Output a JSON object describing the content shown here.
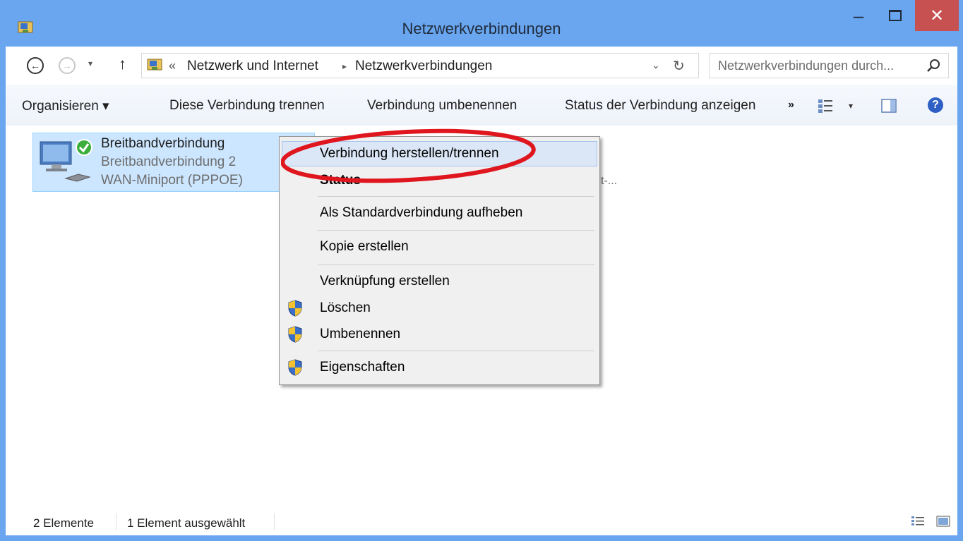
{
  "window": {
    "title": "Netzwerkverbindungen",
    "minimize_glyph": "‒",
    "close_glyph": "✕"
  },
  "address_bar": {
    "back_glyph": "←",
    "forward_glyph": "→",
    "history_glyph": "▾",
    "up_glyph": "↑",
    "overflow_glyph": "«",
    "breadcrumbs": [
      "Netzwerk und Internet",
      "Netzwerkverbindungen"
    ],
    "crumb_separator": "▸",
    "dropdown_glyph": "⌄",
    "refresh_glyph": "↻",
    "search_placeholder": "Netzwerkverbindungen durch..."
  },
  "toolbar": {
    "organize": "Organisieren ▾",
    "disconnect": "Diese Verbindung trennen",
    "rename": "Verbindung umbenennen",
    "status": "Status der Verbindung anzeigen",
    "more": "»",
    "view_drop": "▾",
    "help": "?"
  },
  "connection": {
    "name": "Breitbandverbindung",
    "subtitle": "Breitbandverbindung 2",
    "device": "WAN-Miniport (PPPOE)",
    "partial_text": "t-..."
  },
  "context_menu": {
    "items": [
      {
        "label": "Verbindung herstellen/trennen",
        "shield": false,
        "highlighted": true
      },
      {
        "label": "Status",
        "shield": false,
        "bold": true
      },
      {
        "label": "Als Standardverbindung aufheben",
        "shield": false
      },
      {
        "label": "Kopie erstellen",
        "shield": false
      },
      {
        "label": "Verknüpfung erstellen",
        "shield": false
      },
      {
        "label": "Löschen",
        "shield": true
      },
      {
        "label": "Umbenennen",
        "shield": true
      },
      {
        "label": "Eigenschaften",
        "shield": true
      }
    ]
  },
  "status_bar": {
    "item_count": "2 Elemente",
    "selected": "1 Element ausgewählt"
  },
  "colors": {
    "titlebar": "#6aa6ef",
    "close_button": "#c75050",
    "selection": "#cce6ff",
    "annotation": "#e0161f"
  }
}
